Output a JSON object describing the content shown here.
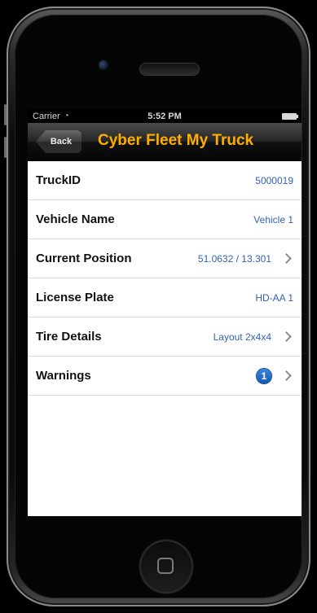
{
  "status_bar": {
    "carrier": "Carrier",
    "time": "5:52 PM"
  },
  "nav_bar": {
    "back_label": "Back",
    "title": "Cyber Fleet My Truck"
  },
  "rows": [
    {
      "label": "TruckID",
      "value": "5000019",
      "chevron": false
    },
    {
      "label": "Vehicle Name",
      "value": "Vehicle 1",
      "chevron": false
    },
    {
      "label": "Current Position",
      "value": "51.0632 / 13.301",
      "chevron": true
    },
    {
      "label": "License Plate",
      "value": "HD-AA 1",
      "chevron": false
    },
    {
      "label": "Tire Details",
      "value": "Layout 2x4x4",
      "chevron": true
    },
    {
      "label": "Warnings",
      "badge": "1",
      "chevron": true
    }
  ],
  "colors": {
    "title": "#ffae00",
    "value": "#2f62b6",
    "badge": "#1f6fd0"
  }
}
